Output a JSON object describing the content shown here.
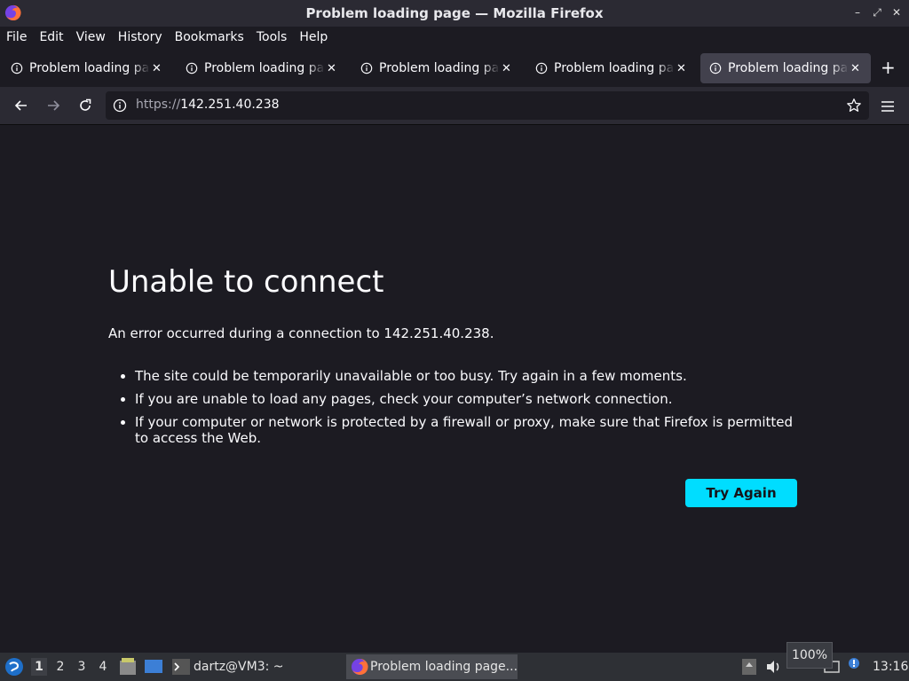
{
  "window": {
    "title": "Problem loading page — Mozilla Firefox"
  },
  "menu": [
    "File",
    "Edit",
    "View",
    "History",
    "Bookmarks",
    "Tools",
    "Help"
  ],
  "tabs": [
    {
      "label": "Problem loading page",
      "active": false
    },
    {
      "label": "Problem loading page",
      "active": false
    },
    {
      "label": "Problem loading page",
      "active": false
    },
    {
      "label": "Problem loading page",
      "active": false
    },
    {
      "label": "Problem loading page",
      "active": true
    }
  ],
  "url": {
    "scheme": "https://",
    "host": "142.251.40.238"
  },
  "error": {
    "title": "Unable to connect",
    "description": "An error occurred during a connection to 142.251.40.238.",
    "bullets": [
      "The site could be temporarily unavailable or too busy. Try again in a few moments.",
      "If you are unable to load any pages, check your computer’s network connection.",
      "If your computer or network is protected by a firewall or proxy, make sure that Firefox is permitted to access the Web."
    ],
    "button": "Try Again"
  },
  "taskbar": {
    "workspaces": [
      "1",
      "2",
      "3",
      "4"
    ],
    "terminal_label": "dartz@VM3: ~",
    "firefox_label": "Problem loading page...",
    "volume_tooltip": "100%",
    "clock": "13:16"
  },
  "colors": {
    "accent": "#00ddff",
    "page_bg": "#1c1b22",
    "toolbar_bg": "#2b2a33"
  }
}
